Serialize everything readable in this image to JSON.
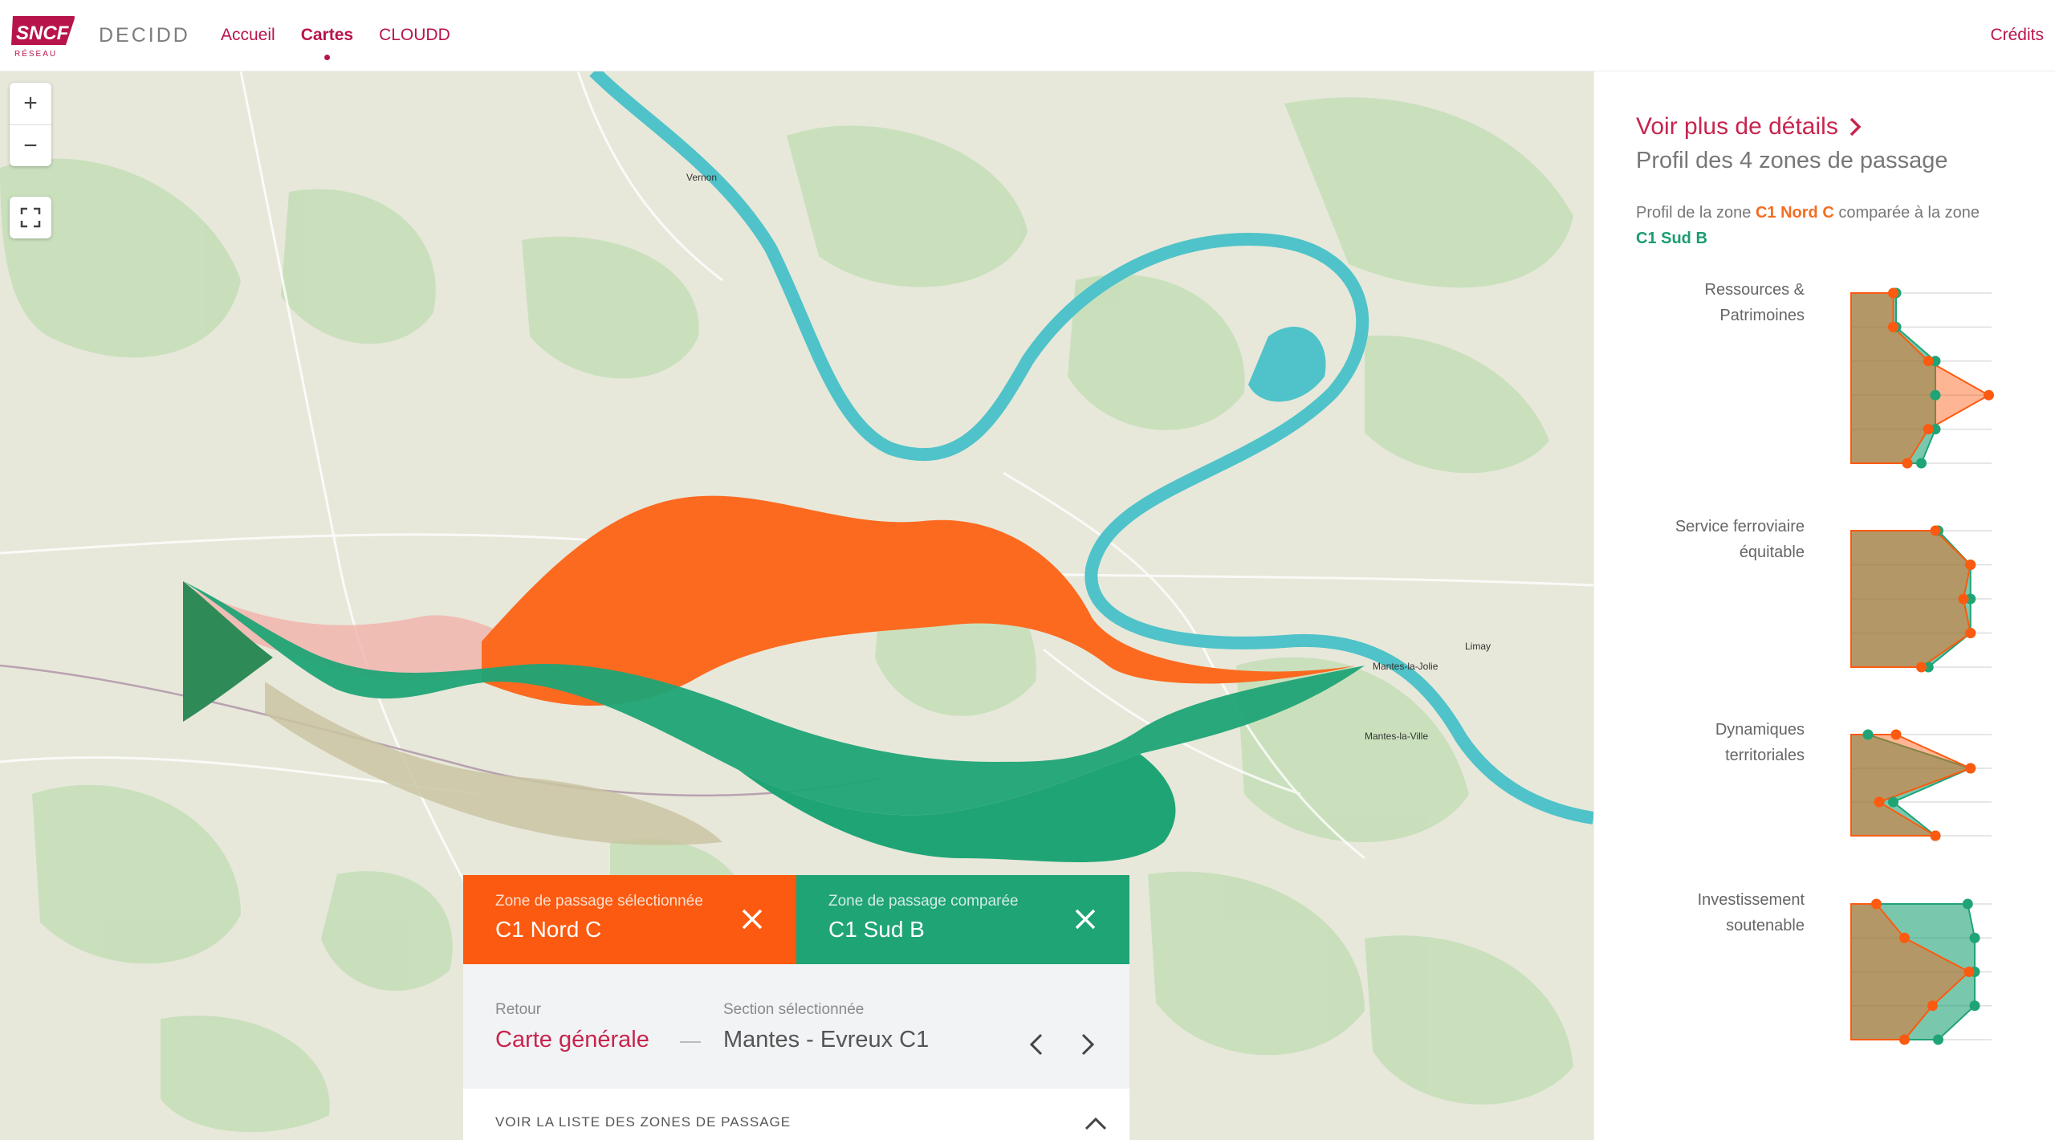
{
  "header": {
    "brand_lines": [
      "SNCF",
      "RÉSEAU"
    ],
    "app_name": "DECIDD",
    "nav": [
      {
        "label": "Accueil",
        "active": false
      },
      {
        "label": "Cartes",
        "active": true
      },
      {
        "label": "CLOUDD",
        "active": false
      }
    ],
    "credits": "Crédits"
  },
  "colors": {
    "brand": "#b8144c",
    "selected": "#fc5a10",
    "compared": "#1fa476",
    "overlap": "#6f9a6c"
  },
  "map": {
    "labels": [
      "Vernon",
      "Limay",
      "Mantes-la-Jolie",
      "Mantes-la-Ville"
    ],
    "controls": {
      "zoom_in": "+",
      "zoom_out": "−",
      "fullscreen_icon": "fullscreen-icon"
    }
  },
  "zones": {
    "selected": {
      "kicker": "Zone de passage sélectionnée",
      "name": "C1 Nord C"
    },
    "compared": {
      "kicker": "Zone de passage comparée",
      "name": "C1 Sud B"
    }
  },
  "navigation": {
    "back_kicker": "Retour",
    "back_label": "Carte générale",
    "section_kicker": "Section sélectionnée",
    "section_name": "Mantes - Evreux C1"
  },
  "list": {
    "label": "VOIR LA LISTE DES ZONES DE PASSAGE"
  },
  "side": {
    "details_link": "Voir plus de détails",
    "profile_title": "Profil des 4 zones de passage",
    "compare_prefix": "Profil de la zone ",
    "compare_selected": "C1 Nord C",
    "compare_middle": " comparée à la zone ",
    "compare_compared": "C1 Sud B",
    "criteria": [
      {
        "label_lines": [
          "Ressources &",
          "Patrimoines"
        ]
      },
      {
        "label_lines": [
          "Service ferroviaire",
          "équitable"
        ]
      },
      {
        "label_lines": [
          "Dynamiques",
          "territoriales"
        ]
      },
      {
        "label_lines": [
          "Investissement",
          "soutenable"
        ]
      }
    ]
  },
  "chart_data": {
    "type": "line",
    "description_scale": "score per sub-criterion, 0 to 1",
    "series": [
      {
        "name": "C1 Nord C"
      },
      {
        "name": "C1 Sud B"
      }
    ],
    "charts": [
      {
        "criterion": "Ressources & Patrimoines",
        "selected": [
          0.3,
          0.3,
          0.55,
          0.98,
          0.55,
          0.4
        ],
        "compared": [
          0.32,
          0.32,
          0.6,
          0.6,
          0.6,
          0.5
        ]
      },
      {
        "criterion": "Service ferroviaire équitable",
        "selected": [
          0.6,
          0.85,
          0.8,
          0.85,
          0.5
        ],
        "compared": [
          0.62,
          0.85,
          0.85,
          0.85,
          0.55
        ]
      },
      {
        "criterion": "Dynamiques territoriales",
        "selected": [
          0.32,
          0.85,
          0.2,
          0.6
        ],
        "compared": [
          0.12,
          0.85,
          0.3,
          0.6
        ]
      },
      {
        "criterion": "Investissement soutenable",
        "selected": [
          0.18,
          0.38,
          0.84,
          0.58,
          0.38
        ],
        "compared": [
          0.83,
          0.88,
          0.88,
          0.88,
          0.62
        ]
      }
    ]
  }
}
